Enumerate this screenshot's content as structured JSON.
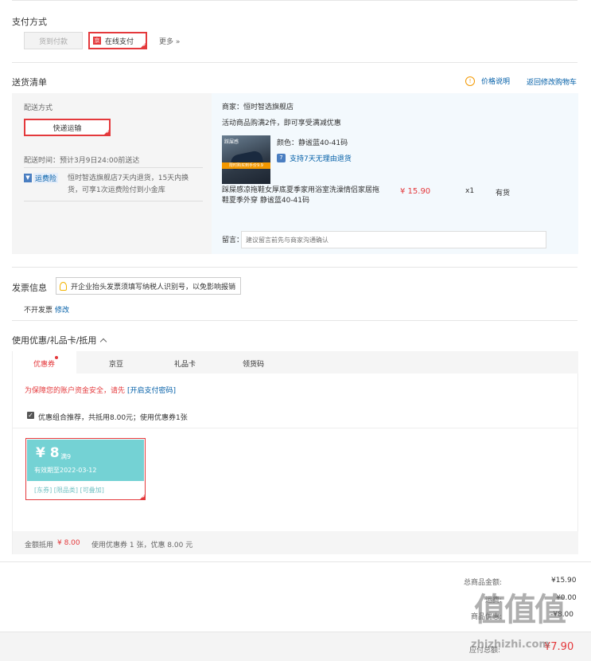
{
  "payment": {
    "title": "支付方式",
    "cod_label": "货到付款",
    "online_label": "在线支付",
    "more_label": "更多 »"
  },
  "delivery": {
    "title": "送货清单",
    "price_note_label": "价格说明",
    "back_cart_label": "返回修改购物车",
    "method_label": "配送方式",
    "method_value": "快递运输",
    "time_text": "配送时间：预计3月9日24:00前送达",
    "insurance_badge": "运费险",
    "insurance_text": "恒时智选旗舰店7天内退货，15天内换货，可享1次运费险付到小金库",
    "shop_text": "商家：恒时智选旗舰店",
    "promo_text": "活动商品购满2件，即可享受满减优惠",
    "product": {
      "thumb_top": "踩屎感",
      "thumb_banner": "限时购买到手价9.9",
      "color_text": "颜色：静谧蓝40-41码",
      "return_text": "支持7天无理由退货",
      "name": "踩屎感凉拖鞋女厚底夏季家用浴室洗澡情侣家居拖鞋夏季外穿 静谧蓝40-41码",
      "price": "¥ 15.90",
      "qty": "x1",
      "stock": "有货"
    },
    "remark_label": "留言：",
    "remark_placeholder": "建议留言前先与商家沟通确认"
  },
  "invoice": {
    "title": "发票信息",
    "tip": "开企业抬头发票须填写纳税人识别号，以免影响报销",
    "status": "不开发票",
    "modify_label": "修改"
  },
  "coupons": {
    "title": "使用优惠/礼品卡/抵用",
    "tabs": [
      "优惠券",
      "京豆",
      "礼品卡",
      "领货码"
    ],
    "security_text": "为保障您的账户资金安全，请先",
    "security_link": "[开启支付密码]",
    "recommend_text": "优惠组合推荐，共抵用8.00元；使用优惠券1张",
    "card": {
      "amount": "¥ 8",
      "condition": "满9",
      "expiry": "有效期至2022-03-12",
      "tags": "[东券] [限品类] [可叠加]"
    },
    "summary_prefix": "金额抵用",
    "summary_amount": "¥ 8.00",
    "summary_suffix": "使用优惠券 1 张，优惠 8.00 元"
  },
  "totals": {
    "goods_label": "总商品金额:",
    "goods_value": "¥15.90",
    "freight_label": "运费:",
    "freight_value": "¥0.00",
    "discount_label": "商品优惠:",
    "discount_value": "-¥8.00",
    "payable_label": "应付总额:",
    "payable_value": "¥7.90"
  },
  "watermark": {
    "logo": "值",
    "site": "zhizhizhi.com"
  },
  "colors": {
    "accent_red": "#e4393c",
    "link_blue": "#005ea7",
    "coupon_teal": "#74d2d4",
    "panel_blue": "#f3f9fd"
  }
}
